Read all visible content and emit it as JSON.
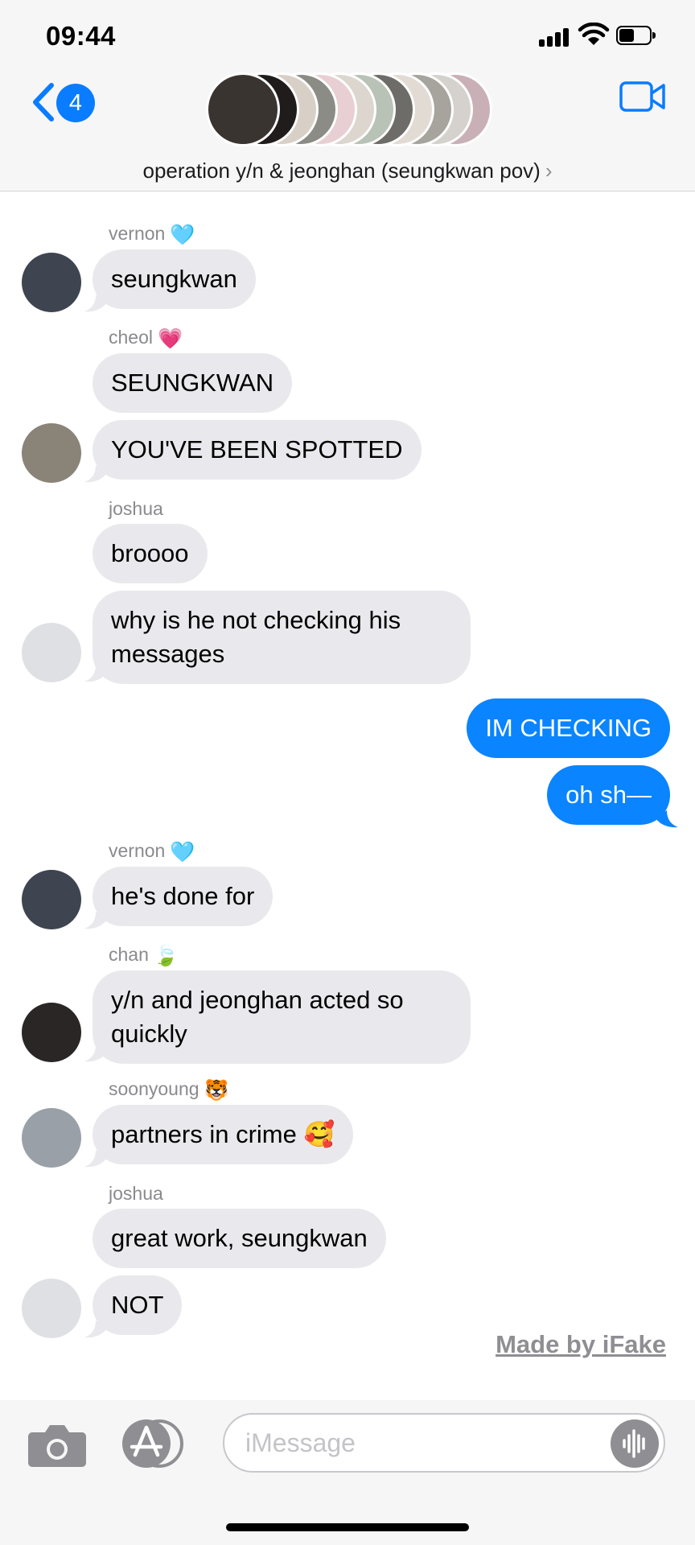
{
  "status_bar": {
    "time": "09:44",
    "battery_level": 0.55
  },
  "header": {
    "unread_count": "4",
    "title": "operation y/n & jeonghan (seungkwan pov)",
    "chevron": "›",
    "back_icon": "chevron-left-icon",
    "video_icon": "video-camera-icon"
  },
  "messages": [
    {
      "sender": "vernon",
      "emoji": "🩵",
      "text": "seungkwan",
      "direction": "in"
    },
    {
      "sender": "cheol",
      "emoji": "💗",
      "text": "SEUNGKWAN",
      "direction": "in"
    },
    {
      "text": "YOU'VE BEEN SPOTTED",
      "direction": "in"
    },
    {
      "sender": "joshua",
      "text": "broooo",
      "direction": "in"
    },
    {
      "text": "why is he not checking his messages",
      "direction": "in"
    },
    {
      "text": "IM CHECKING",
      "direction": "out"
    },
    {
      "text": "oh sh—",
      "direction": "out"
    },
    {
      "sender": "vernon",
      "emoji": "🩵",
      "text": "he's done for",
      "direction": "in"
    },
    {
      "sender": "chan",
      "emoji": "🍃",
      "text": "y/n and jeonghan acted so quickly",
      "direction": "in"
    },
    {
      "sender": "soonyoung",
      "emoji": "🐯",
      "text": "partners in crime 🥰",
      "direction": "in"
    },
    {
      "sender": "joshua",
      "text": "great work, seungkwan",
      "direction": "in"
    },
    {
      "text": "NOT",
      "direction": "in"
    }
  ],
  "watermark": "Made by iFake",
  "input": {
    "placeholder": "iMessage",
    "camera_icon": "camera-icon",
    "apps_icon": "app-store-icon",
    "voice_icon": "audio-waveform-icon"
  },
  "colors": {
    "outgoing": "#0a84ff",
    "incoming": "#e9e9ed",
    "badge": "#0a7cff"
  }
}
